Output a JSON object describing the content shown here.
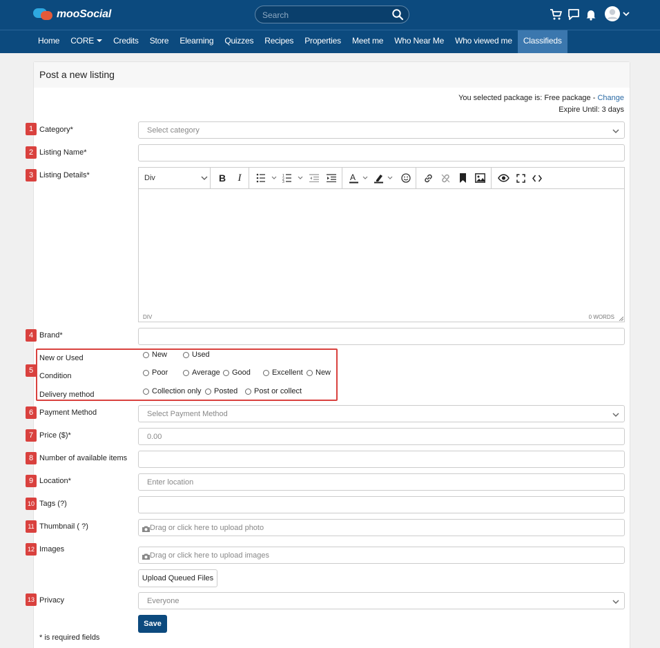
{
  "app": {
    "name": "mooSocial"
  },
  "search": {
    "placeholder": "Search"
  },
  "nav": {
    "items": [
      {
        "label": "Home"
      },
      {
        "label": "CORE"
      },
      {
        "label": "Credits"
      },
      {
        "label": "Store"
      },
      {
        "label": "Elearning"
      },
      {
        "label": "Quizzes"
      },
      {
        "label": "Recipes"
      },
      {
        "label": "Properties"
      },
      {
        "label": "Meet me"
      },
      {
        "label": "Who Near Me"
      },
      {
        "label": "Who viewed me"
      },
      {
        "label": "Classifieds"
      }
    ],
    "active": "Classifieds"
  },
  "page": {
    "title": "Post a new listing",
    "package_text": "You selected package is: Free package - ",
    "package_link": "Change",
    "expire_text": "Expire Until: 3 days"
  },
  "form": {
    "category": {
      "num": "1",
      "label": "Category*",
      "placeholder": "Select category"
    },
    "listing_name": {
      "num": "2",
      "label": "Listing Name*",
      "value": ""
    },
    "listing_details": {
      "num": "3",
      "label": "Listing Details*",
      "block_format": "Div",
      "status_left": "DIV",
      "status_right": "0 WORDS"
    },
    "brand": {
      "num": "4",
      "label": "Brand*",
      "value": ""
    },
    "group5": {
      "num": "5",
      "new_or_used": {
        "label": "New or Used",
        "options": [
          "New",
          "Used"
        ]
      },
      "condition": {
        "label": "Condition",
        "options": [
          "Poor",
          "Average",
          "Good",
          "Excellent",
          "New"
        ]
      },
      "delivery": {
        "label": "Delivery method",
        "options": [
          "Collection only",
          "Posted",
          "Post or collect"
        ]
      }
    },
    "payment_method": {
      "num": "6",
      "label": "Payment Method",
      "placeholder": "Select Payment Method"
    },
    "price": {
      "num": "7",
      "label": "Price ($)*",
      "value": "0.00"
    },
    "items": {
      "num": "8",
      "label": "Number of available items",
      "value": ""
    },
    "location": {
      "num": "9",
      "label": "Location*",
      "placeholder": "Enter location"
    },
    "tags": {
      "num": "10",
      "label": "Tags (?)",
      "value": ""
    },
    "thumbnail": {
      "num": "11",
      "label": "Thumbnail ( ?)",
      "placeholder": "Drag or click here to upload photo"
    },
    "images": {
      "num": "12",
      "label": "Images",
      "placeholder": "Drag or click here to upload images",
      "upload_button": "Upload Queued Files"
    },
    "privacy": {
      "num": "13",
      "label": "Privacy",
      "value": "Everyone"
    },
    "save_button": "Save",
    "required_note": "* is required fields"
  },
  "colors": {
    "header": "#0c4a7e",
    "active_nav": "#3b77ae",
    "marker": "#d9413e",
    "link": "#2a6aa5"
  },
  "icons": [
    "search-icon",
    "cart-icon",
    "chat-icon",
    "bell-icon",
    "avatar-icon",
    "chevron-down-icon",
    "camera-icon"
  ]
}
